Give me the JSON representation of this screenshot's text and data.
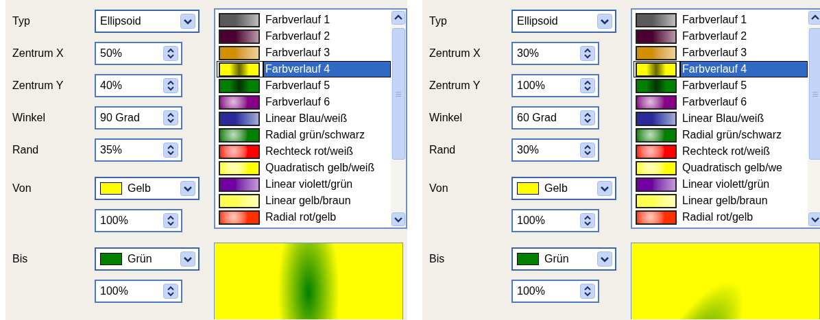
{
  "panels": [
    {
      "fields": [
        {
          "kind": "dropdown",
          "label": "Typ",
          "value": "Ellipsoid"
        },
        {
          "kind": "spin",
          "label": "Zentrum X",
          "value": "50%"
        },
        {
          "kind": "spin",
          "label": "Zentrum Y",
          "value": "40%"
        },
        {
          "kind": "spin",
          "label": "Winkel",
          "value": "90 Grad"
        },
        {
          "kind": "spin",
          "label": "Rand",
          "value": "35%"
        },
        {
          "kind": "color",
          "label": "Von",
          "value": "Gelb",
          "color": "#ffff00"
        },
        {
          "kind": "spin",
          "value": "100%"
        },
        {
          "kind": "color",
          "label": "Bis",
          "value": "Grün",
          "color": "#008000"
        },
        {
          "kind": "spin",
          "value": "100%"
        }
      ],
      "gradients": [
        {
          "name": "Farbverlauf 1",
          "kind": "linear",
          "color": "#5a5a5a",
          "selected": false
        },
        {
          "name": "Farbverlauf 2",
          "kind": "linear",
          "color": "#4a0030",
          "selected": false
        },
        {
          "name": "Farbverlauf 3",
          "kind": "linear",
          "color": "#d09000",
          "selected": false
        },
        {
          "name": "Farbverlauf 4",
          "kind": "axial",
          "color": "#ffff00",
          "selected": true
        },
        {
          "name": "Farbverlauf 5",
          "kind": "axial",
          "color": "#008000",
          "selected": false
        },
        {
          "name": "Farbverlauf 6",
          "kind": "radial",
          "color": "#880088",
          "selected": false
        },
        {
          "name": "Linear Blau/weiß",
          "kind": "linear",
          "color": "#2a2a9a",
          "selected": false
        },
        {
          "name": "Radial grün/schwarz",
          "kind": "radial",
          "color": "#008000",
          "selected": false
        },
        {
          "name": "Rechteck rot/weiß",
          "kind": "radial",
          "color": "#ff0000",
          "selected": false
        },
        {
          "name": "Quadratisch gelb/weiß",
          "kind": "radial",
          "color": "#ffff00",
          "selected": false
        },
        {
          "name": "Linear violett/grün",
          "kind": "linear",
          "color": "#7000a0",
          "selected": false
        },
        {
          "name": "Linear gelb/braun",
          "kind": "linear",
          "color": "#ffff50",
          "selected": false
        },
        {
          "name": "Radial rot/gelb",
          "kind": "radial",
          "color": "#ff3000",
          "selected": false
        }
      ]
    },
    {
      "fields": [
        {
          "kind": "dropdown",
          "label": "Typ",
          "value": "Ellipsoid"
        },
        {
          "kind": "spin",
          "label": "Zentrum X",
          "value": "30%"
        },
        {
          "kind": "spin",
          "label": "Zentrum Y",
          "value": "100%"
        },
        {
          "kind": "spin",
          "label": "Winkel",
          "value": "60 Grad"
        },
        {
          "kind": "spin",
          "label": "Rand",
          "value": "30%"
        },
        {
          "kind": "color",
          "label": "Von",
          "value": "Gelb",
          "color": "#ffff00"
        },
        {
          "kind": "spin",
          "value": "100%"
        },
        {
          "kind": "color",
          "label": "Bis",
          "value": "Grün",
          "color": "#008000"
        },
        {
          "kind": "spin",
          "value": "100%"
        }
      ],
      "gradients": [
        {
          "name": "Farbverlauf 1",
          "kind": "linear",
          "color": "#5a5a5a",
          "selected": false
        },
        {
          "name": "Farbverlauf 2",
          "kind": "linear",
          "color": "#4a0030",
          "selected": false
        },
        {
          "name": "Farbverlauf 3",
          "kind": "linear",
          "color": "#d09000",
          "selected": false
        },
        {
          "name": "Farbverlauf 4",
          "kind": "axial",
          "color": "#ffff00",
          "selected": true
        },
        {
          "name": "Farbverlauf 5",
          "kind": "axial",
          "color": "#008000",
          "selected": false
        },
        {
          "name": "Farbverlauf 6",
          "kind": "radial",
          "color": "#880088",
          "selected": false
        },
        {
          "name": "Linear Blau/weiß",
          "kind": "linear",
          "color": "#2a2a9a",
          "selected": false
        },
        {
          "name": "Radial grün/schwarz",
          "kind": "radial",
          "color": "#008000",
          "selected": false
        },
        {
          "name": "Rechteck rot/weiß",
          "kind": "radial",
          "color": "#ff0000",
          "selected": false
        },
        {
          "name": "Quadratisch gelb/we",
          "kind": "radial",
          "color": "#ffff00",
          "selected": false
        },
        {
          "name": "Linear violett/grün",
          "kind": "linear",
          "color": "#7000a0",
          "selected": false
        },
        {
          "name": "Linear gelb/braun",
          "kind": "linear",
          "color": "#ffff50",
          "selected": false
        },
        {
          "name": "Radial rot/gelb",
          "kind": "radial",
          "color": "#ff3000",
          "selected": false
        }
      ]
    }
  ]
}
